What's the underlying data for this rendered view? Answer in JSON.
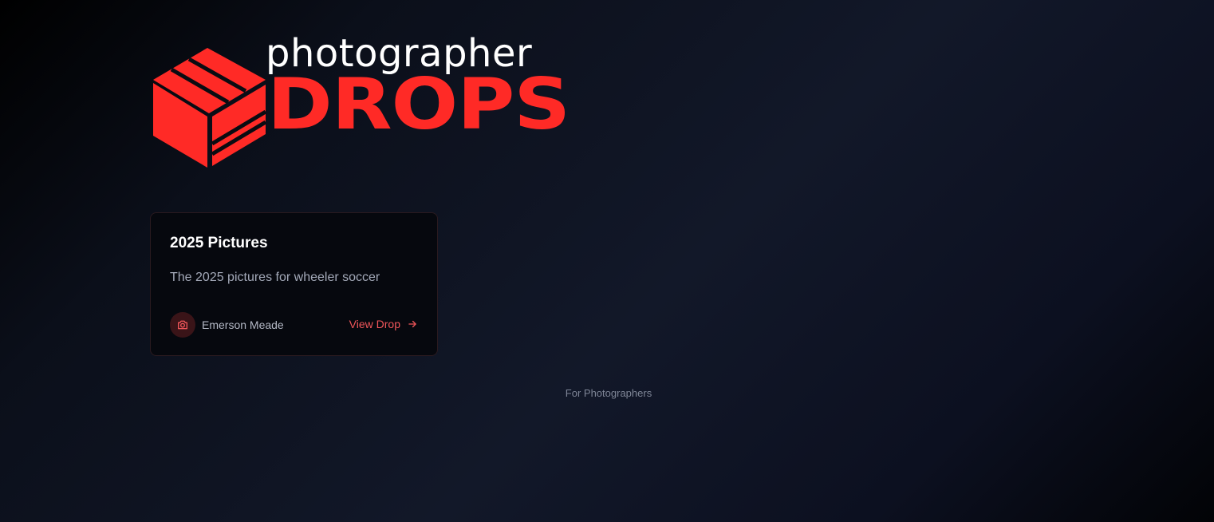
{
  "brand": {
    "word_top": "photographer",
    "word_bottom": "DROPS",
    "accent_color": "#ff2a26",
    "icon": "box-icon"
  },
  "drops": [
    {
      "title": "2025 Pictures",
      "description": "The 2025 pictures for wheeler soccer",
      "author": "Emerson Meade",
      "author_icon": "camera-icon",
      "link_label": "View Drop",
      "link_icon": "arrow-right-icon"
    }
  ],
  "footer": {
    "link_label": "For Photographers"
  }
}
